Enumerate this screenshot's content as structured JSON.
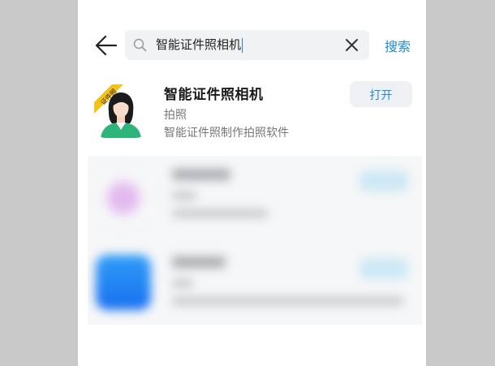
{
  "search": {
    "query": "智能证件照相机",
    "action_label": "搜索"
  },
  "result": {
    "app_name": "智能证件照相机",
    "category": "拍照",
    "description": "智能证件照制作拍照软件",
    "button_label": "打开",
    "icon_badge": "证件照"
  },
  "colors": {
    "accent": "#1e8cd7",
    "page_background": "#c9c9c9",
    "search_background": "#f1f2f4",
    "icon_badge": "#f3c21a",
    "icon_shirt": "#2fb47c"
  },
  "icons": [
    "back-arrow-icon",
    "search-icon",
    "close-icon"
  ]
}
